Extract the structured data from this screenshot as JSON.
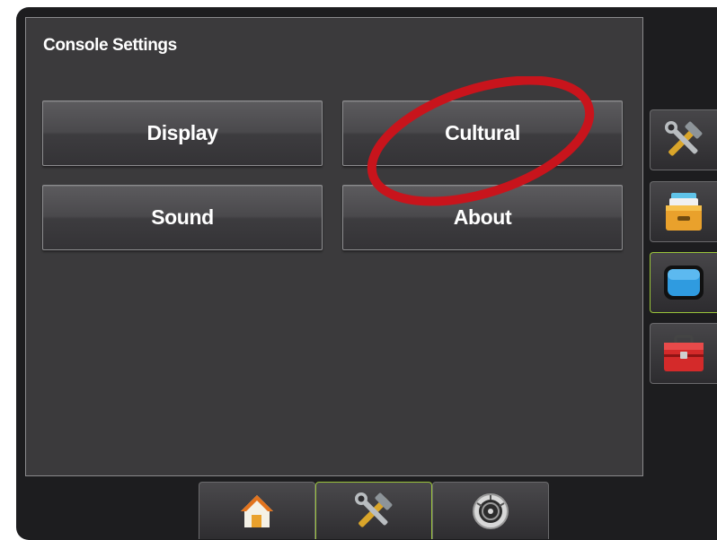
{
  "panel": {
    "title": "Console Settings"
  },
  "buttons": {
    "display": "Display",
    "cultural": "Cultural",
    "sound": "Sound",
    "about": "About"
  },
  "side_tabs": [
    {
      "icon": "wrench-hammer-icon",
      "active": false
    },
    {
      "icon": "file-drawer-icon",
      "active": false
    },
    {
      "icon": "monitor-icon",
      "active": true
    },
    {
      "icon": "toolbox-icon",
      "active": false
    }
  ],
  "bottom_tabs": [
    {
      "icon": "home-icon",
      "active": false
    },
    {
      "icon": "wrench-hammer-icon",
      "active": true
    },
    {
      "icon": "speedometer-icon",
      "active": false
    }
  ],
  "annotation": {
    "shape": "red-ellipse",
    "target": "cultural-button",
    "color": "#c8141c"
  },
  "colors": {
    "background": "#3b3a3c",
    "active_border": "#9ac43a",
    "text": "#ffffff"
  }
}
